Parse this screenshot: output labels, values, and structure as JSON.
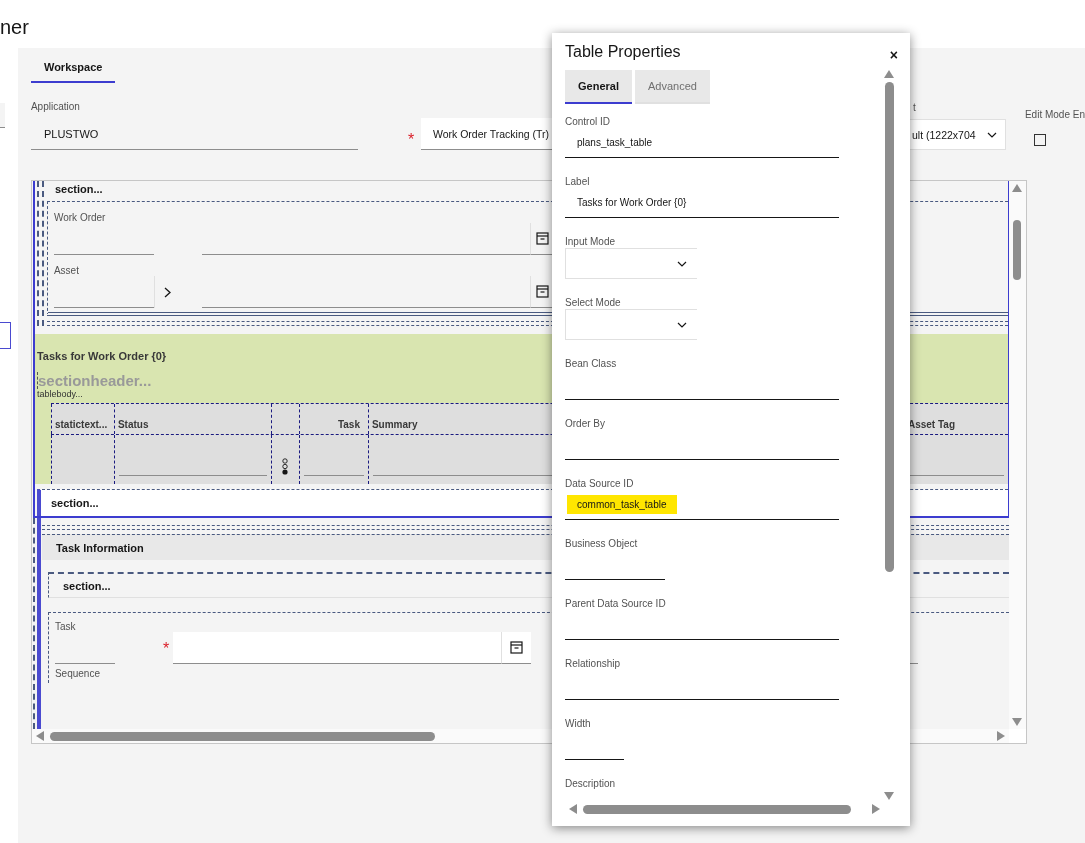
{
  "header": {
    "title": "ner"
  },
  "workspace_tab": {
    "label": "Workspace",
    "selected": true
  },
  "application": {
    "label": "Application",
    "value": "PLUSTWO"
  },
  "app_select": {
    "marker": "*",
    "value": "Work Order Tracking (Tr)"
  },
  "layout": {
    "label": "t",
    "value": "ult (1222x704"
  },
  "edit_mode": {
    "label": "Edit Mode En",
    "checked": false
  },
  "canvas": {
    "top_section": {
      "label": "section..."
    },
    "fields": [
      {
        "label": "Work Order",
        "kind": "lookup"
      },
      {
        "label": "Asset",
        "kind": "detail-lookup"
      }
    ],
    "table": {
      "title": "Tasks for Work Order {0}",
      "header_label": "sectionheader...",
      "body_label": "tablebody...",
      "columns": [
        {
          "label": "statictext...",
          "kind": "static"
        },
        {
          "label": "Status",
          "kind": "text"
        },
        {
          "kind": "toggle"
        },
        {
          "label": "Task",
          "kind": "numeric"
        },
        {
          "label": "Summary",
          "kind": "text"
        },
        {
          "label": "Asset Tag",
          "kind": "text"
        }
      ],
      "footer_section": "section..."
    },
    "task_info": {
      "title": "Task Information",
      "section": "section...",
      "fields": [
        {
          "label": "Task",
          "marker": "*"
        },
        {
          "label": "Sequence"
        }
      ]
    }
  },
  "dialog": {
    "title": "Table Properties",
    "close": "×",
    "tabs": [
      {
        "label": "General",
        "selected": true
      },
      {
        "label": "Advanced",
        "selected": false
      }
    ],
    "fields": [
      {
        "label": "Control ID",
        "kind": "text",
        "value": "plans_task_table",
        "highlighted": false
      },
      {
        "label": "Label",
        "kind": "text",
        "value": "Tasks for Work Order {0}",
        "highlighted": false
      },
      {
        "label": "Input Mode",
        "kind": "select",
        "highlighted": false
      },
      {
        "label": "Select Mode",
        "kind": "select",
        "highlighted": false
      },
      {
        "label": "Bean Class",
        "kind": "text",
        "highlighted": false
      },
      {
        "label": "Order By",
        "kind": "text",
        "highlighted": false
      },
      {
        "label": "Data Source ID",
        "kind": "text",
        "value": "common_task_table",
        "highlighted": true
      },
      {
        "label": "Business Object",
        "kind": "narrow",
        "highlighted": false
      },
      {
        "label": "Parent Data Source ID",
        "kind": "text",
        "highlighted": false
      },
      {
        "label": "Relationship",
        "kind": "text",
        "highlighted": false
      },
      {
        "label": "Width",
        "kind": "tiny",
        "highlighted": false
      },
      {
        "label": "Description",
        "kind": "cut",
        "highlighted": false
      }
    ]
  }
}
